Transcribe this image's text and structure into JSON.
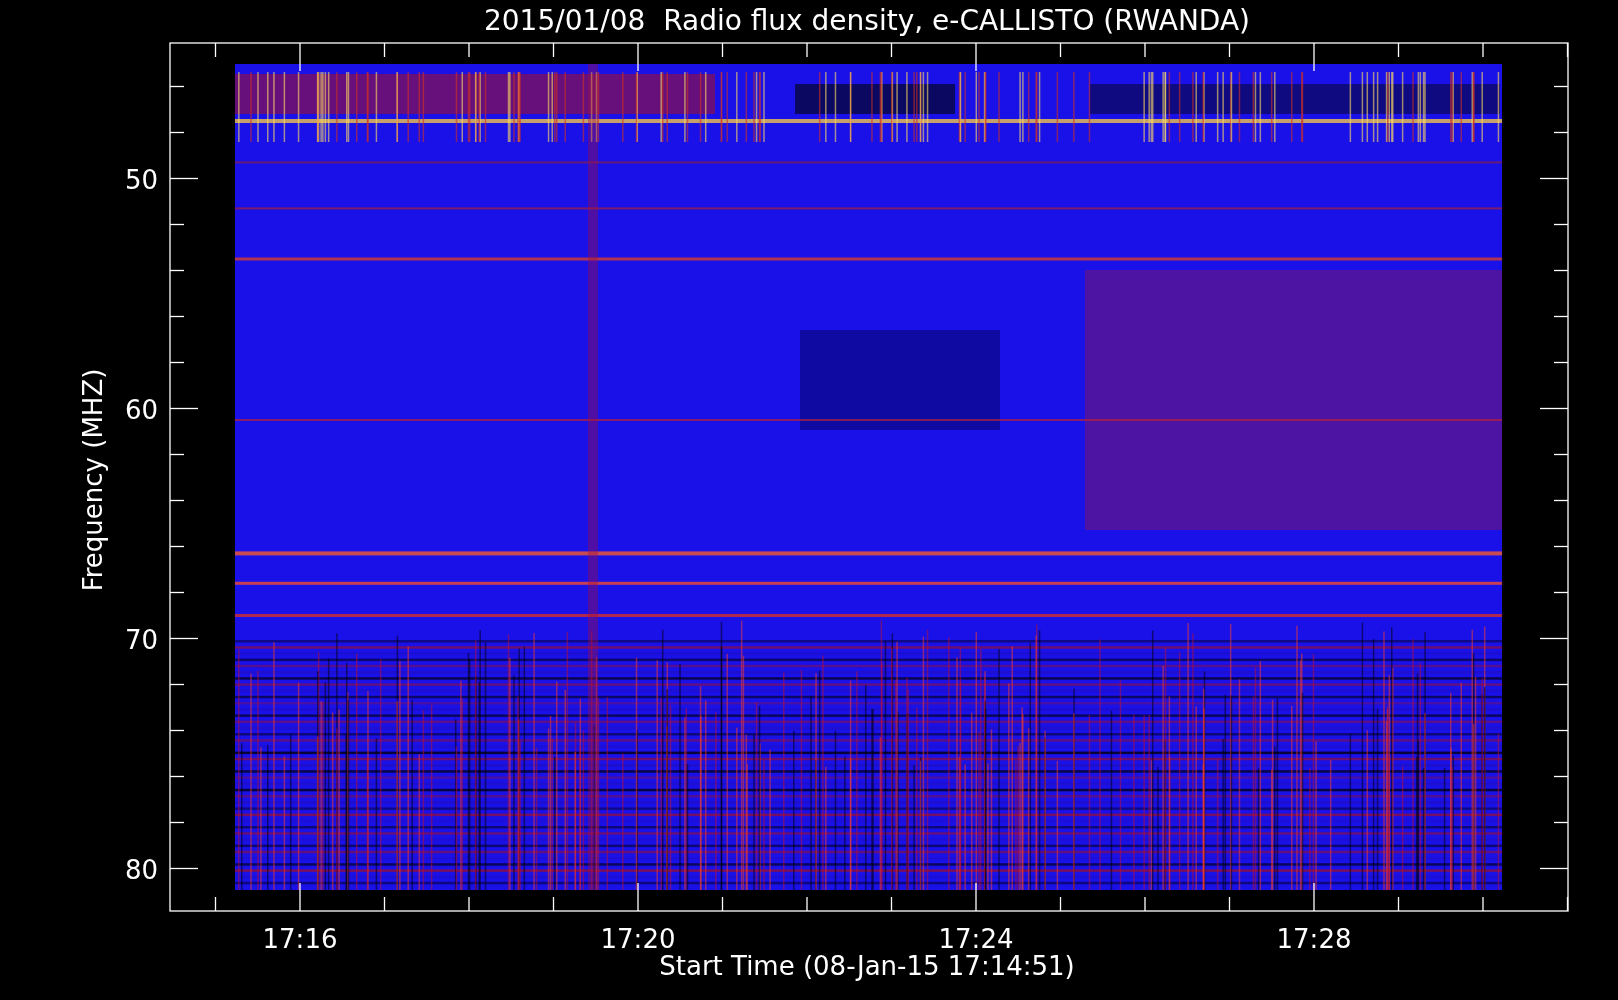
{
  "title": "2015/01/08  Radio flux density, e-CALLISTO (RWANDA)",
  "y_axis": {
    "label": "Frequency (MHZ)",
    "ticks": [
      "50",
      "60",
      "70",
      "80"
    ]
  },
  "x_axis": {
    "label": "Start Time (08-Jan-15 17:14:51)",
    "ticks": [
      "17:16",
      "17:20",
      "17:24",
      "17:28"
    ]
  }
}
